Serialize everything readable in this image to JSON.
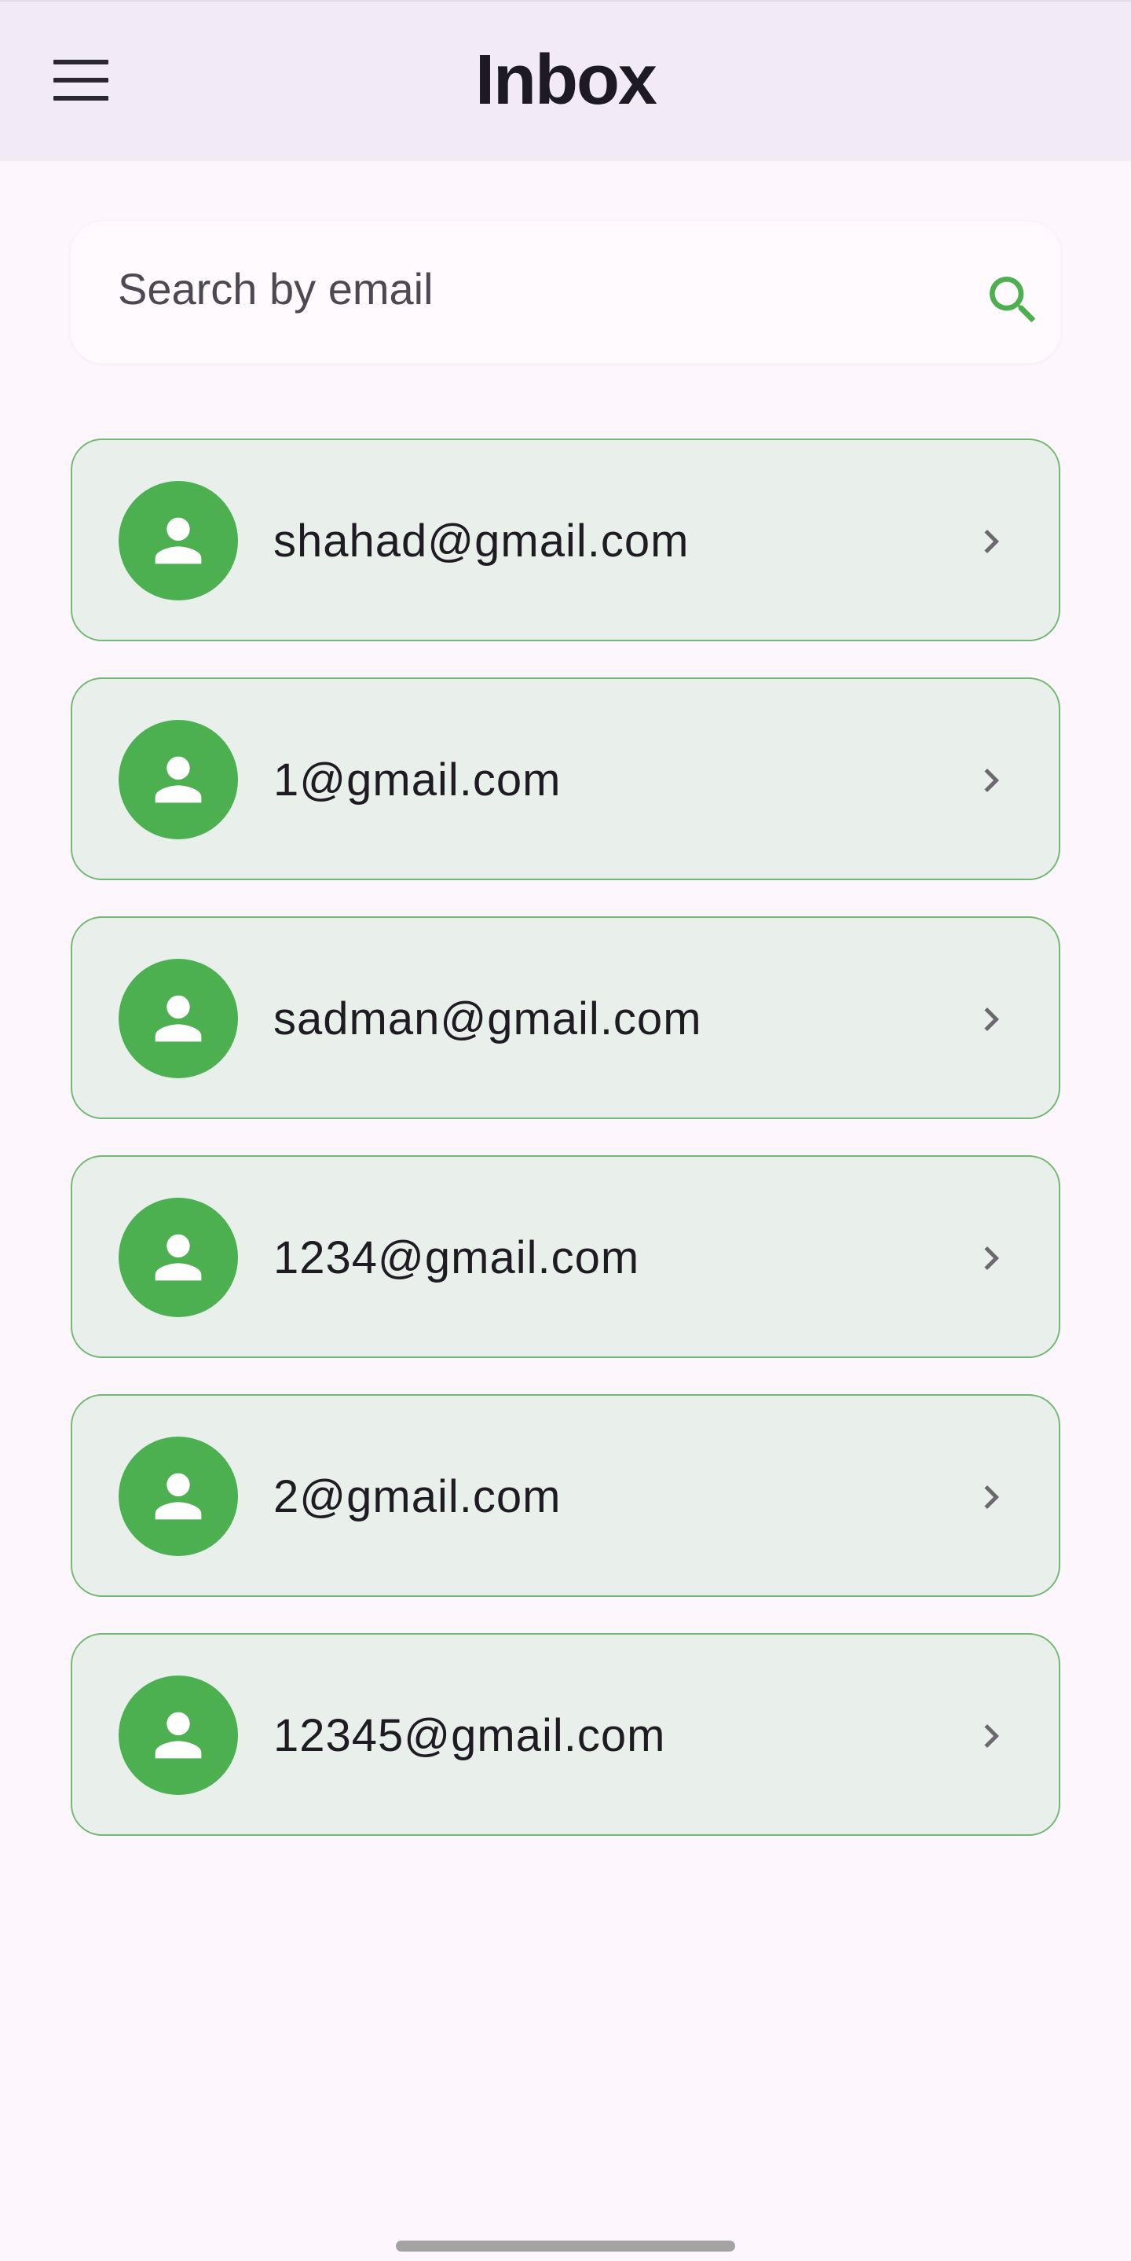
{
  "app_bar": {
    "title": "Inbox",
    "menu_icon": "hamburger-menu-icon",
    "background": "#f2ebf6"
  },
  "search": {
    "placeholder": "Search by email",
    "value": "",
    "icon": "search-icon",
    "icon_color": "#4caf50"
  },
  "inbox": {
    "items": [
      {
        "email": "shahad@gmail.com",
        "avatar_icon": "person-icon",
        "trailing_icon": "chevron-right-icon"
      },
      {
        "email": "1@gmail.com",
        "avatar_icon": "person-icon",
        "trailing_icon": "chevron-right-icon"
      },
      {
        "email": "sadman@gmail.com",
        "avatar_icon": "person-icon",
        "trailing_icon": "chevron-right-icon"
      },
      {
        "email": "1234@gmail.com",
        "avatar_icon": "person-icon",
        "trailing_icon": "chevron-right-icon"
      },
      {
        "email": "2@gmail.com",
        "avatar_icon": "person-icon",
        "trailing_icon": "chevron-right-icon"
      },
      {
        "email": "12345@gmail.com",
        "avatar_icon": "person-icon",
        "trailing_icon": "chevron-right-icon"
      }
    ]
  },
  "colors": {
    "accent": "#4caf50",
    "card_background": "#e9efea",
    "card_border": "#73b874",
    "page_background": "#fdf7fd"
  }
}
